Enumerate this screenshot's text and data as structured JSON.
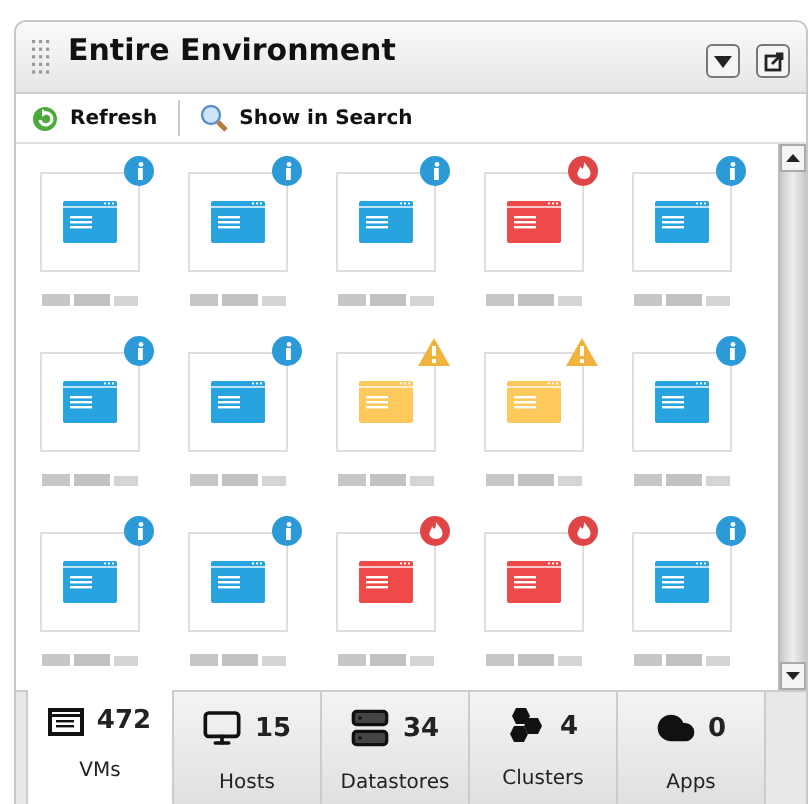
{
  "panel": {
    "title": "Entire Environment"
  },
  "toolbar": [
    {
      "label": "Refresh",
      "kind": "refresh"
    },
    {
      "label": "Show in Search",
      "kind": "search"
    }
  ],
  "tiles": [
    {
      "kind": "info"
    },
    {
      "kind": "info"
    },
    {
      "kind": "info"
    },
    {
      "kind": "critical"
    },
    {
      "kind": "info"
    },
    {
      "kind": "info"
    },
    {
      "kind": "info"
    },
    {
      "kind": "warning"
    },
    {
      "kind": "warning"
    },
    {
      "kind": "info"
    },
    {
      "kind": "info"
    },
    {
      "kind": "info"
    },
    {
      "kind": "critical"
    },
    {
      "kind": "critical"
    },
    {
      "kind": "info"
    }
  ],
  "tabs": [
    {
      "kind": "vms",
      "count": "472",
      "label": "VMs",
      "selected": true
    },
    {
      "kind": "hosts",
      "count": "15",
      "label": "Hosts",
      "selected": false
    },
    {
      "kind": "datastores",
      "count": "34",
      "label": "Datastores",
      "selected": false
    },
    {
      "kind": "clusters",
      "count": "4",
      "label": "Clusters",
      "selected": false
    },
    {
      "kind": "apps",
      "count": "0",
      "label": "Apps",
      "selected": false
    }
  ]
}
